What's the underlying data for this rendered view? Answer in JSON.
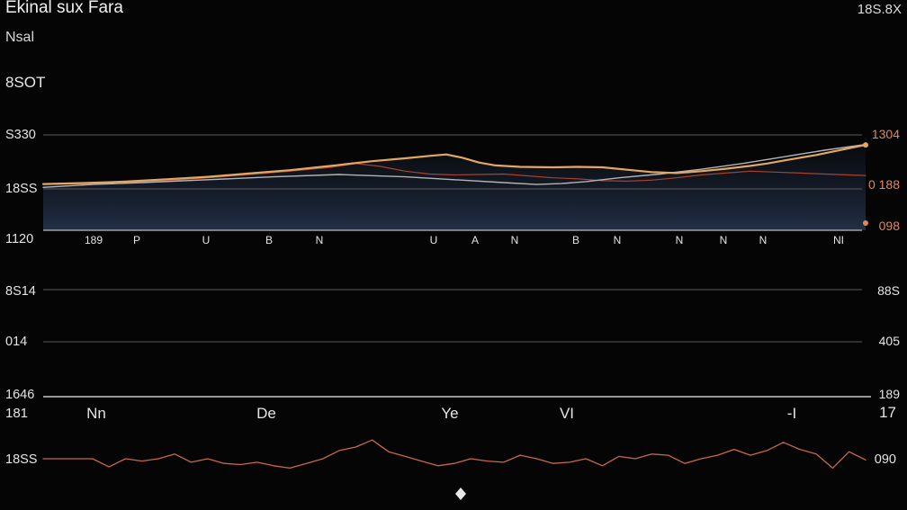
{
  "header": {
    "title": "Ekinal sux Fara",
    "subtitle": "Nsal",
    "top_value": "8SOT",
    "corner_label": "18S.8X"
  },
  "colors": {
    "background": "#050506",
    "grid": "#5a5a5a",
    "gold_line": "#e2a863",
    "red_line": "#a8432f",
    "gray_line": "#b4b4b4",
    "lower_line": "#c9674a",
    "right_orange_labels": "#e0885a",
    "band_fill": "#1b2638"
  },
  "chart_data": [
    {
      "type": "line",
      "title": "",
      "y_labels_left": [
        "S330",
        "18SS",
        "1120",
        "8S14",
        "014",
        "1646"
      ],
      "y_labels_right": [
        {
          "text": "1304",
          "color": "orange"
        },
        {
          "text": "0 188",
          "color": "orange"
        },
        {
          "text": "098",
          "color": "orange"
        },
        {
          "text": "88S",
          "color": "light"
        },
        {
          "text": "405",
          "color": "light"
        },
        {
          "text": "189",
          "color": "light"
        }
      ],
      "inner_tick_labels": [
        "189",
        "P",
        "U",
        "B",
        "N",
        "U",
        "A",
        "N",
        "B",
        "N",
        "N",
        "N",
        "N",
        "NI"
      ],
      "x_tick_labels": [
        "Nn",
        "De",
        "Ye",
        "VI",
        "-I"
      ],
      "axis_left_label": "181",
      "axis_right_label": "17",
      "y_range": [
        0,
        100
      ],
      "grid": true,
      "series": [
        {
          "key": "gold",
          "x": [
            0,
            5,
            10,
            15,
            20,
            25,
            30,
            35,
            40,
            44,
            47,
            49,
            51,
            53,
            55,
            58,
            62,
            65,
            68,
            71,
            74,
            77,
            80,
            83,
            86,
            88,
            90,
            92,
            94,
            96,
            98,
            100
          ],
          "y": [
            48.5,
            49.5,
            51,
            53.5,
            56,
            59.5,
            63,
            67.5,
            72.5,
            75.5,
            78,
            79.5,
            76,
            71,
            68,
            66.5,
            66,
            66.5,
            66,
            63.5,
            61,
            60,
            62,
            64.5,
            67.5,
            70,
            73,
            76,
            79,
            82.5,
            86,
            89.5
          ]
        },
        {
          "key": "red",
          "x": [
            0,
            5,
            10,
            15,
            20,
            25,
            30,
            35,
            38,
            41,
            44,
            47,
            50,
            53,
            56,
            59,
            62,
            65,
            68,
            71,
            74,
            77,
            80,
            83,
            86,
            89,
            92,
            95,
            98,
            100
          ],
          "y": [
            48.5,
            49,
            50,
            52,
            55,
            58.5,
            62,
            66,
            70,
            67,
            62,
            59,
            58,
            58.5,
            59,
            57,
            55,
            54,
            52,
            51.5,
            52.5,
            55,
            58,
            60,
            62,
            61,
            60,
            59,
            58,
            57.5
          ]
        },
        {
          "key": "gray",
          "x": [
            0,
            6,
            12,
            20,
            28,
            36,
            44,
            50,
            56,
            60,
            63,
            66,
            70,
            75,
            80,
            85,
            90,
            95,
            100
          ],
          "y": [
            45,
            48,
            50,
            53,
            56,
            58.5,
            56,
            53,
            50,
            48,
            49,
            51,
            55,
            59,
            64,
            70,
            77,
            84,
            90
          ]
        },
        {
          "key": "lower",
          "x": [
            0,
            2,
            4,
            6,
            8,
            10,
            12,
            14,
            16,
            18,
            20,
            22,
            24,
            26,
            28,
            30,
            32,
            34,
            36,
            38,
            40,
            42,
            44,
            46,
            48,
            50,
            52,
            54,
            56,
            58,
            60,
            62,
            64,
            66,
            68,
            70,
            72,
            74,
            76,
            78,
            80,
            82,
            84,
            86,
            88,
            90,
            92,
            94,
            96,
            98,
            100
          ],
          "y": [
            0,
            0,
            0,
            0,
            -7,
            0,
            -2,
            0,
            4,
            -3,
            0,
            -4,
            -5,
            -3,
            -6,
            -8,
            -4,
            0,
            7,
            10,
            16,
            6,
            2,
            -2,
            -6,
            -4,
            0,
            -2,
            -3,
            3,
            0,
            -4,
            -3,
            0,
            -6,
            2,
            0,
            4,
            3,
            -4,
            0,
            3,
            8,
            3,
            7,
            14,
            8,
            4,
            -8,
            6,
            -1
          ]
        }
      ]
    }
  ]
}
